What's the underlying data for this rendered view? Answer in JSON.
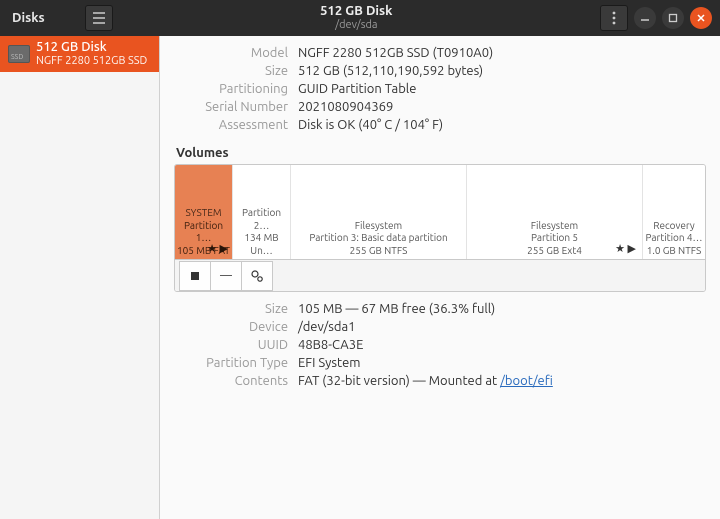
{
  "titlebar": {
    "app": "Disks",
    "title": "512 GB Disk",
    "subtitle": "/dev/sda"
  },
  "sidebar": {
    "disk_name": "512 GB Disk",
    "disk_desc": "NGFF 2280 512GB SSD",
    "ssd_badge": "SSD"
  },
  "drive": {
    "labels": {
      "model": "Model",
      "size": "Size",
      "partitioning": "Partitioning",
      "serial": "Serial Number",
      "assessment": "Assessment"
    },
    "model": "NGFF 2280 512GB SSD (T0910A0)",
    "size": "512 GB (512,110,190,592 bytes)",
    "partitioning": "GUID Partition Table",
    "serial": "2021080904369",
    "assessment": "Disk is OK (40° C / 104° F)"
  },
  "volumes_header": "Volumes",
  "volumes": [
    {
      "line1": "SYSTEM",
      "line2": "Partition 1…",
      "line3": "105 MB FAT"
    },
    {
      "line1": "",
      "line2": "Partition 2…",
      "line3": "134 MB Un…"
    },
    {
      "line1": "Filesystem",
      "line2": "Partition 3: Basic data partition",
      "line3": "255 GB NTFS"
    },
    {
      "line1": "Filesystem",
      "line2": "Partition 5",
      "line3": "255 GB Ext4"
    },
    {
      "line1": "Recovery",
      "line2": "Partition 4…",
      "line3": "1.0 GB NTFS"
    }
  ],
  "partition": {
    "labels": {
      "size": "Size",
      "device": "Device",
      "uuid": "UUID",
      "ptype": "Partition Type",
      "contents": "Contents"
    },
    "size": "105 MB — 67 MB free (36.3% full)",
    "device": "/dev/sda1",
    "uuid": "48B8-CA3E",
    "ptype": "EFI System",
    "contents_pre": "FAT (32-bit version) — Mounted at ",
    "contents_link": "/boot/efi"
  }
}
